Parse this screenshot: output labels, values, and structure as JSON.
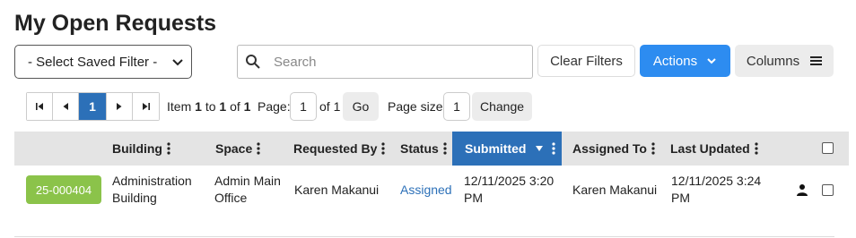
{
  "page": {
    "title": "My Open Requests"
  },
  "toolbar": {
    "saved_filter": "- Select Saved Filter -",
    "search_placeholder": "Search",
    "clear_filters": "Clear Filters",
    "actions": "Actions",
    "columns": "Columns"
  },
  "pagination": {
    "current_page": "1",
    "item_prefix": "Item",
    "item_from": "1",
    "item_to_word": "to",
    "item_to": "1",
    "item_of_word": "of",
    "item_total": "1",
    "page_label": "Page:",
    "page_value": "1",
    "page_of": "of 1",
    "go": "Go",
    "page_size_label": "Page size:",
    "page_size_value": "1",
    "change": "Change"
  },
  "table": {
    "columns": [
      "Building",
      "Space",
      "Requested By",
      "Status",
      "Submitted",
      "Assigned To",
      "Last Updated"
    ],
    "rows": [
      {
        "request_id": "25-000404",
        "building_line1": "Administration",
        "building_line2": "Building",
        "space_line1": "Admin Main",
        "space_line2": "Office",
        "requested_by": "Karen Makanui",
        "status": "Assigned",
        "submitted_line1": "12/11/2025 3:20",
        "submitted_line2": "PM",
        "assigned_to": "Karen Makanui",
        "last_updated_line1": "12/11/2025 3:24",
        "last_updated_line2": "PM"
      }
    ]
  },
  "colors": {
    "primary": "#2d8cf0",
    "header_sorted": "#2c70b8",
    "badge": "#8bc34a",
    "header_bg": "#e4e4e4"
  }
}
